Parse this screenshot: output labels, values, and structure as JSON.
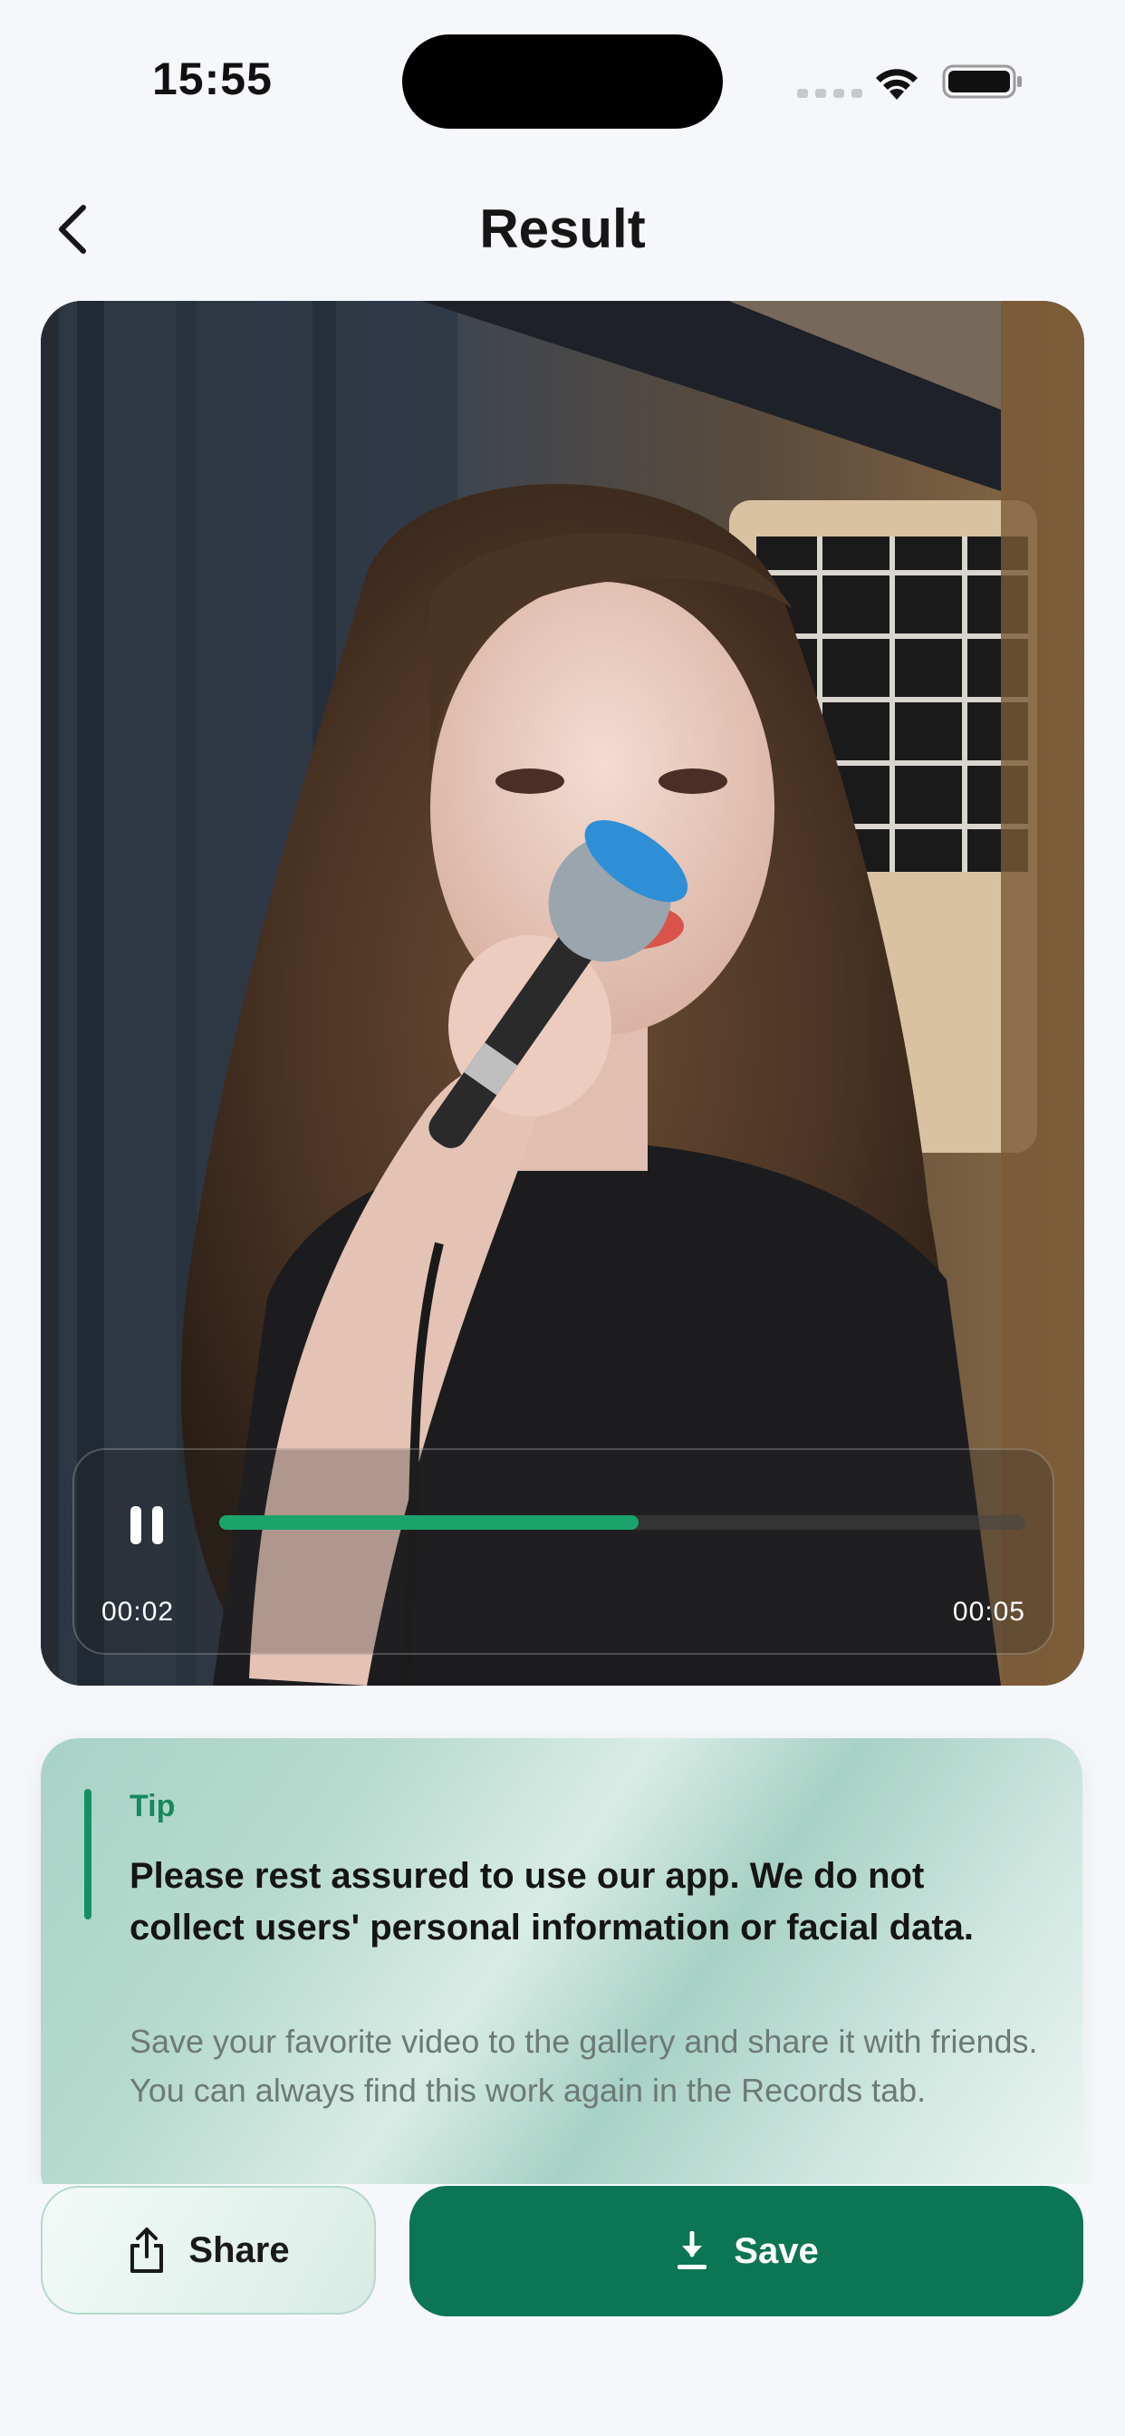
{
  "status_bar": {
    "time": "15:55"
  },
  "header": {
    "title": "Result",
    "back_icon": "chevron-left-icon"
  },
  "player": {
    "state": "playing",
    "current_time": "00:02",
    "total_time": "00:05",
    "progress": 0.52,
    "accent_color": "#1aa46b"
  },
  "tip": {
    "label": "Tip",
    "headline": "Please rest assured to use our app. We do not collect users' personal information or facial data.",
    "body": "Save your favorite video to the gallery and share it with friends. You can always find this work again in the Records tab."
  },
  "actions": {
    "share_label": "Share",
    "share_icon": "share-icon",
    "save_label": "Save",
    "save_icon": "download-icon",
    "save_color": "#0c7554"
  }
}
